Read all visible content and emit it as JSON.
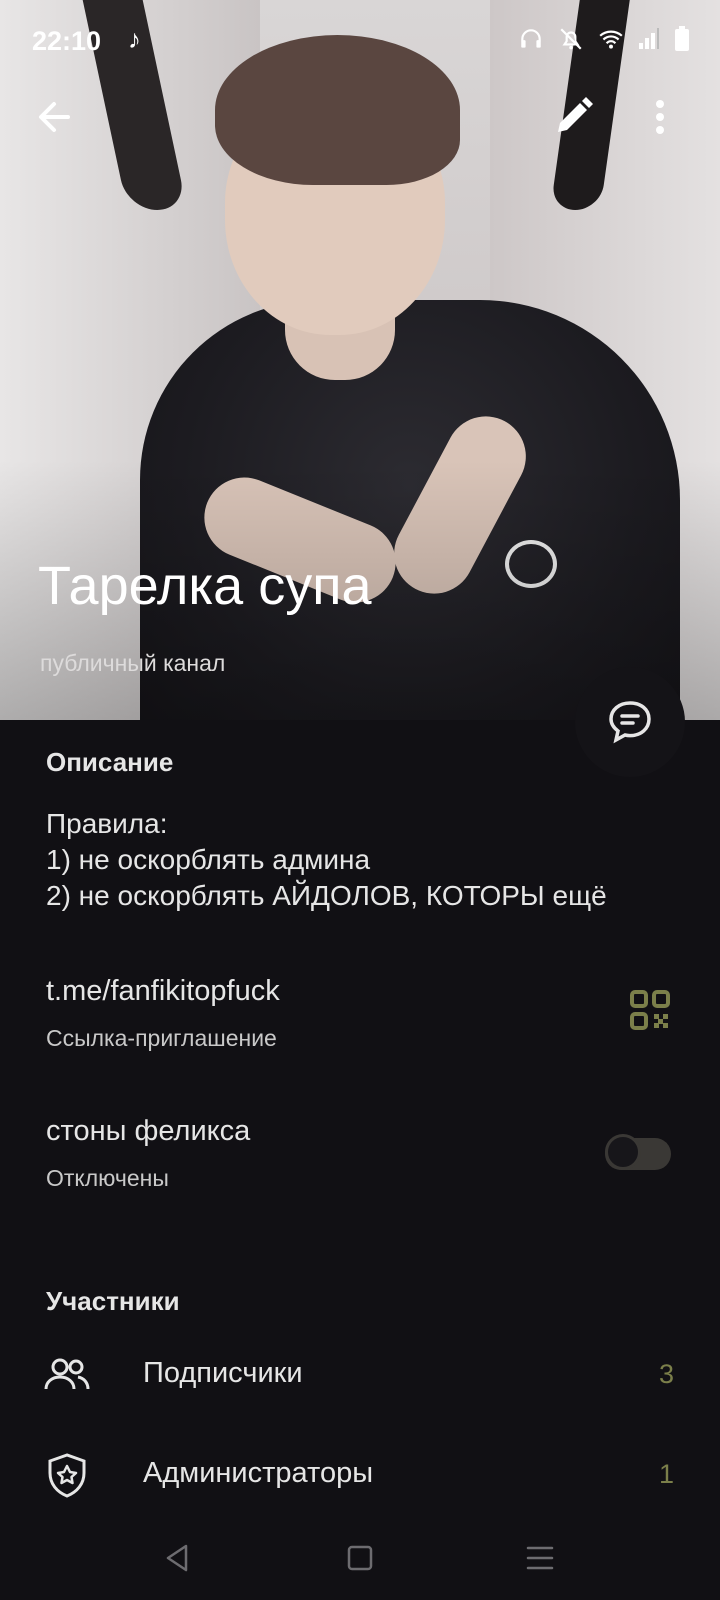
{
  "status_bar": {
    "time": "22:10"
  },
  "channel": {
    "title": "Тарелка супа",
    "subtitle": "публичный канал"
  },
  "description": {
    "section_title": "Описание",
    "lines": [
      "Правила:",
      "1) не оскорблять админа",
      "2) не оскорблять АЙДОЛОВ, КОТОРЫ ещё"
    ]
  },
  "invite_link": {
    "url": "t.me/fanfikitopfuck",
    "label": "Ссылка-приглашение"
  },
  "notifications": {
    "title": "стоны феликса",
    "state": "Отключены",
    "enabled": false
  },
  "participants": {
    "section_title": "Участники",
    "items": [
      {
        "label": "Подписчики",
        "count": "3",
        "icon": "people-icon"
      },
      {
        "label": "Администраторы",
        "count": "1",
        "icon": "shield-star-icon"
      }
    ]
  },
  "colors": {
    "background": "#111014",
    "accent": "#7b7f4a",
    "text": "#e6e6e6"
  }
}
